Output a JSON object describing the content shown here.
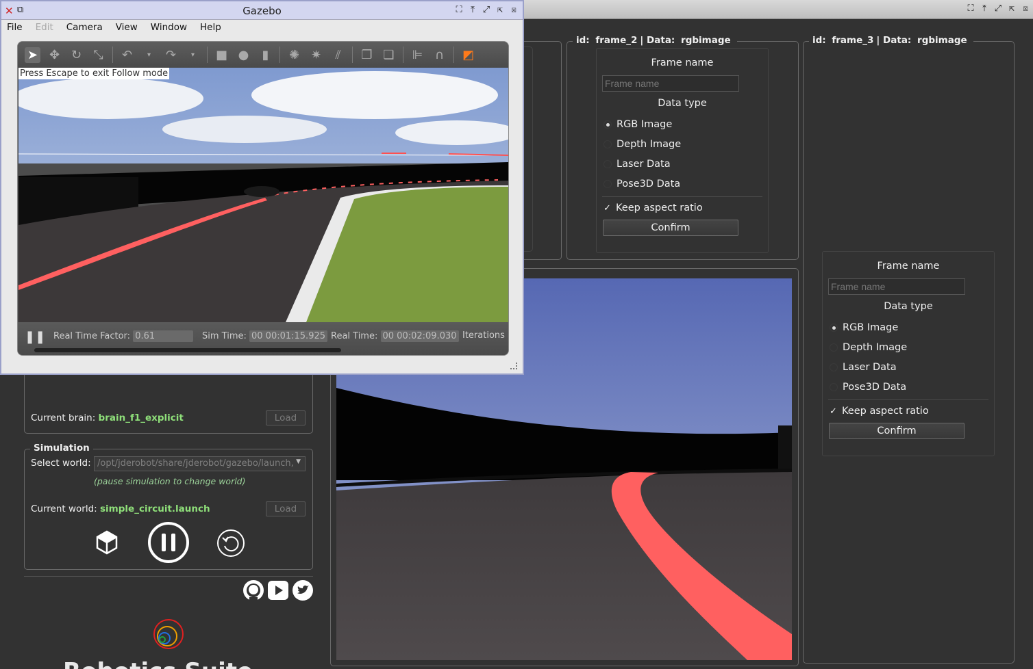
{
  "gazebo": {
    "title": "Gazebo",
    "menu": [
      {
        "label": "File",
        "enabled": true
      },
      {
        "label": "Edit",
        "enabled": false
      },
      {
        "label": "Camera",
        "enabled": true
      },
      {
        "label": "View",
        "enabled": true
      },
      {
        "label": "Window",
        "enabled": true
      },
      {
        "label": "Help",
        "enabled": true
      }
    ],
    "follow_note": "Press Escape to exit Follow mode",
    "status": {
      "rtf_label": "Real Time Factor:",
      "rtf_value": "0.61",
      "sim_label": "Sim Time:",
      "sim_value": "00 00:01:15.925",
      "real_label": "Real Time:",
      "real_value": "00 00:02:09.030",
      "iter_label": "Iterations"
    }
  },
  "frame2": {
    "title_id": "id:",
    "title_frame": "frame_2",
    "title_data": "| Data:",
    "title_type": "rgbimage",
    "frame_name_label": "Frame name",
    "frame_name_placeholder": "Frame name",
    "data_type_label": "Data type",
    "options": [
      "RGB Image",
      "Depth Image",
      "Laser Data",
      "Pose3D Data"
    ],
    "selected": "RGB Image",
    "keep_aspect": "Keep aspect ratio",
    "confirm": "Confirm"
  },
  "frame3": {
    "title_id": "id:",
    "title_frame": "frame_3",
    "title_data": "| Data:",
    "title_type": "rgbimage",
    "frame_name_label": "Frame name",
    "frame_name_placeholder": "Frame name",
    "data_type_label": "Data type",
    "options": [
      "RGB Image",
      "Depth Image",
      "Laser Data",
      "Pose3D Data"
    ],
    "selected": "RGB Image",
    "keep_aspect": "Keep aspect ratio",
    "confirm": "Confirm"
  },
  "left_panel": {
    "current_brain_label": "Current brain:",
    "current_brain_value": "brain_f1_explicit",
    "load_brain": "Load",
    "simulation_title": "Simulation",
    "select_world_label": "Select world:",
    "select_world_value": "/opt/jderobot/share/jderobot/gazebo/launch,",
    "pause_hint": "(pause simulation to change world)",
    "current_world_label": "Current world:",
    "current_world_value": "simple_circuit.launch",
    "load_world": "Load",
    "bottom_title": "Robotics Suite"
  },
  "colors": {
    "accent_green": "#8fe07a",
    "track_line": "#ff5c5c",
    "background": "#323232"
  }
}
